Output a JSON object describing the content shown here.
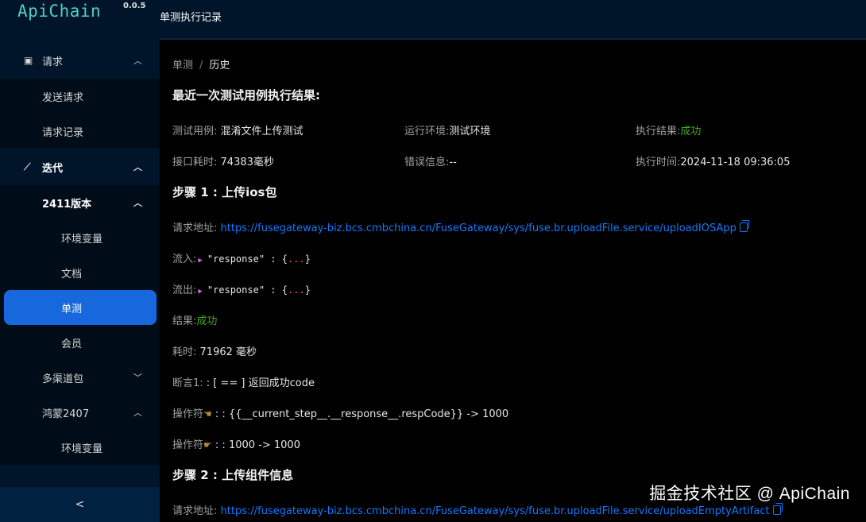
{
  "app": {
    "name": "ApiChain",
    "version": "0.0.5"
  },
  "header": {
    "title": "单测执行记录"
  },
  "sidebar": {
    "request_group": "请求",
    "send_request": "发送请求",
    "request_records": "请求记录",
    "iteration_group": "迭代",
    "version_2411": "2411版本",
    "env_vars": "环境变量",
    "docs": "文档",
    "unit_test": "单测",
    "member": "会员",
    "multi_channel": "多渠道包",
    "harmony_2407": "鸿蒙2407",
    "env_vars_2": "环境变量",
    "collapse": "<"
  },
  "breadcrumb": {
    "parent": "单测",
    "sep": "/",
    "current": "历史"
  },
  "summary": {
    "title": "最近一次测试用例执行结果:",
    "case_label": "测试用例:",
    "case_value": "混淆文件上传测试",
    "env_label": "运行环境:",
    "env_value": "测试环境",
    "result_label": "执行结果:",
    "result_value": "成功",
    "cost_label": "接口耗时:",
    "cost_value": "74383毫秒",
    "error_label": "错误信息:",
    "error_value": "--",
    "time_label": "执行时间:",
    "time_value": "2024-11-18 09:36:05"
  },
  "step1": {
    "title": "步骤 1 : 上传ios包",
    "url_label": "请求地址:",
    "url": "https://fusegateway-biz.bcs.cmbchina.cn/FuseGateway/sys/fuse.br.uploadFile.service/uploadIOSApp",
    "in_label": "流入:",
    "out_label": "流出:",
    "json_key": "\"response\"",
    "json_colon": ":",
    "json_brace_open": "{",
    "json_dots": "...",
    "json_brace_close": "}",
    "result_label": "结果:",
    "result_value": "成功",
    "cost_label": "耗时:",
    "cost_value": "71962 毫秒",
    "assert_label": "断言1:",
    "assert_value": ": [ == ] 返回成功code",
    "op1_label": "操作符",
    "op1_value": ": : {{__current_step__.__response__.respCode}} -> 1000",
    "op2_label": "操作符",
    "op2_value": ": : 1000 -> 1000"
  },
  "step2": {
    "title": "步骤 2 : 上传组件信息",
    "url_label": "请求地址:",
    "url": "https://fusegateway-biz.bcs.cmbchina.cn/FuseGateway/sys/fuse.br.uploadFile.service/uploadEmptyArtifact"
  },
  "watermark": "掘金技术社区 @ ApiChain",
  "colors": {
    "sidebar": "#001529",
    "active": "#1668dc",
    "success": "#49aa19",
    "link": "#1677ff"
  }
}
